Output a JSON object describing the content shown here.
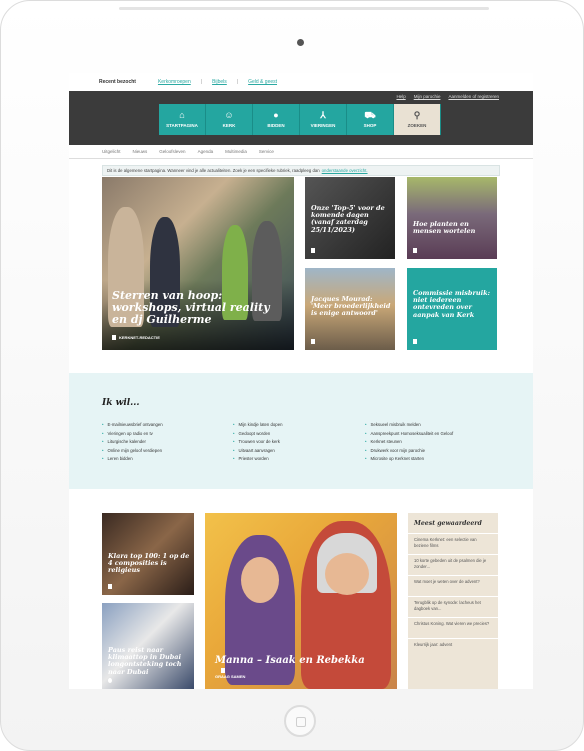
{
  "recent": {
    "label": "Recent bezocht",
    "links": [
      "Kerkomroepen",
      "Bijbels",
      "Geld & geest"
    ]
  },
  "login": {
    "help": "Help",
    "profile": "Mijn parochie",
    "register": "Aanmelden of registreren"
  },
  "nav": [
    {
      "label": "STARTPAGINA",
      "icon": "home-icon"
    },
    {
      "label": "KERK",
      "icon": "people-icon"
    },
    {
      "label": "BIDDEN",
      "icon": "globe-icon"
    },
    {
      "label": "VIERINGEN",
      "icon": "candle-icon"
    },
    {
      "label": "SHOP",
      "icon": "cart-icon"
    },
    {
      "label": "ZOEKEN",
      "icon": "search-icon"
    }
  ],
  "subnav": [
    "Uitgelicht",
    "Nieuws",
    "Geloofsleven",
    "Agenda",
    "Multimedia",
    "Service"
  ],
  "notice": {
    "text": "Dit is de algemene startpagina. Wanneer vind je alle actualiteiten. Zoek je een specifieke rubriek, raadpleeg dan",
    "link": "onderstaande overzicht."
  },
  "hero": {
    "title": "Sterren van hoop: workshops, virtual reality en dj Guilherme",
    "tag": "KERKNET-REDACTIE"
  },
  "tiles": [
    {
      "title": "Onze 'Top-5' voor de komende dagen (vanaf zaterdag 25/11/2023)"
    },
    {
      "title": "Hoe planten en mensen wortelen"
    },
    {
      "title": "Jacques Mourad: 'Meer broederlijkheid is enige antwoord'"
    },
    {
      "title": "Commissie misbruik: niet iedereen ontevreden over aanpak van Kerk"
    }
  ],
  "ikwil": {
    "heading": "Ik wil...",
    "col1": [
      "E-mailnieuwsbrief ontvangen",
      "Vieringen op radio en tv",
      "Liturgische kalender",
      "Online mijn geloof verdiepen",
      "Leren bidden"
    ],
    "col2": [
      "Mijn kindje laten dopen",
      "Gedoopt worden",
      "Trouwen voor de kerk",
      "Uitvaart aanvragen",
      "Priester worden"
    ],
    "col3": [
      "Seksueel misbruik melden",
      "Aanspreekpunt Homoseksualiteit en Geloof",
      "Kerknet steunen",
      "Drukwerk voor mijn parochie",
      "Microsite op Kerknet starten"
    ]
  },
  "bottom_tiles": [
    {
      "title": "Klara top 100: 1 op de 4 composities is religieus"
    },
    {
      "title": "Paus reist naar klimaattop in Dubai",
      "overlay": "longontsteking toch naar Dubai"
    },
    {
      "title": "Manna – Isaak en Rebekka",
      "tag": "GRAAG SAMEN"
    }
  ],
  "sidebar": {
    "heading": "Meest gewaardeerd",
    "items": [
      "Cinema Kerknet: een selectie van beziene films",
      "10 korte gebeden uit de psalmen die je zonder...",
      "Wat moet je weten over de advent?",
      "Terugblik op de synode: lacheus het dagboek van...",
      "Christus Koning. Wat vieren we precies?",
      "Kleurrijk jaar: advent"
    ]
  },
  "colors": {
    "accent": "#24a6a0",
    "dark": "#3b3b3b",
    "beige": "#ede5d7",
    "lightblue": "#e6f4f5"
  }
}
